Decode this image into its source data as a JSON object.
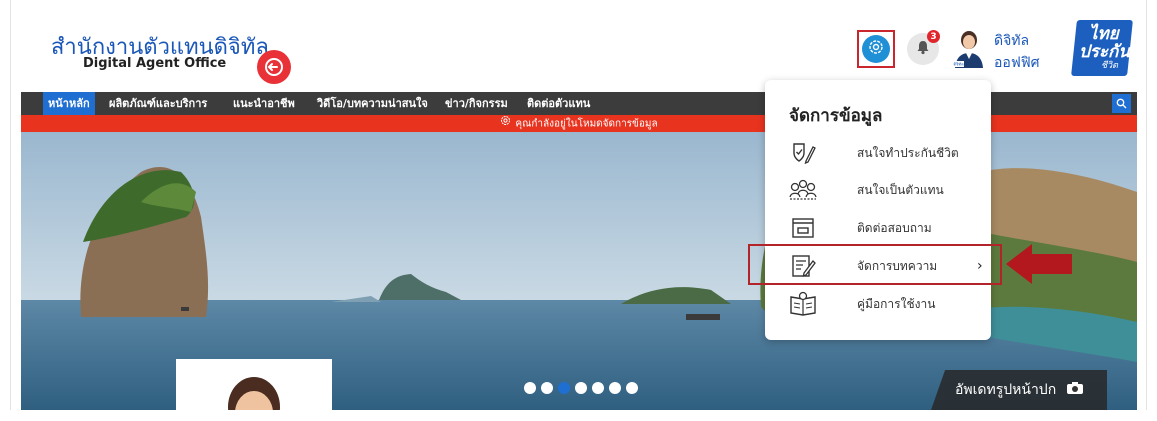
{
  "header": {
    "logo_thai": "สำนักงานตัวแทนดิจิทัล",
    "logo_english": "Digital Agent Office",
    "notification_count": "3",
    "user_name_line1": "ดิจิทัล",
    "user_name_line2": "ออฟฟิศ",
    "brand_line1": "ไทย",
    "brand_line2": "ประกัน",
    "brand_line3": "ชีวิต",
    "avatar_caption": "ดิจิทัล"
  },
  "nav": {
    "items": [
      "หน้าหลัก",
      "ผลิตภัณฑ์และบริการ",
      "แนะนำอาชีพ",
      "วิดีโอ/บทความน่าสนใจ",
      "ข่าว/กิจกรรม",
      "ติดต่อตัวแทน"
    ]
  },
  "notice": "คุณกำลังอยู่ในโหมดจัดการข้อมูล",
  "menu": {
    "title": "จัดการข้อมูล",
    "items": [
      {
        "label": "สนใจทำประกันชีวิต",
        "icon": "shield-pen-icon"
      },
      {
        "label": "สนใจเป็นตัวแทน",
        "icon": "group-people-icon"
      },
      {
        "label": "ติดต่อสอบถาม",
        "icon": "inbox-icon"
      },
      {
        "label": "จัดการบทความ",
        "icon": "document-edit-icon"
      },
      {
        "label": "คู่มือการใช้งาน",
        "icon": "manual-book-icon"
      }
    ],
    "arrow_symbol": "›"
  },
  "hero": {
    "update_cover_label": "อัพเดทรูปหน้าปก",
    "slide_count": 7,
    "active_slide": 3
  },
  "colors": {
    "brand_blue": "#1f6fd3",
    "alert_red": "#e8331f",
    "nav_dark": "#3c3c3c"
  }
}
